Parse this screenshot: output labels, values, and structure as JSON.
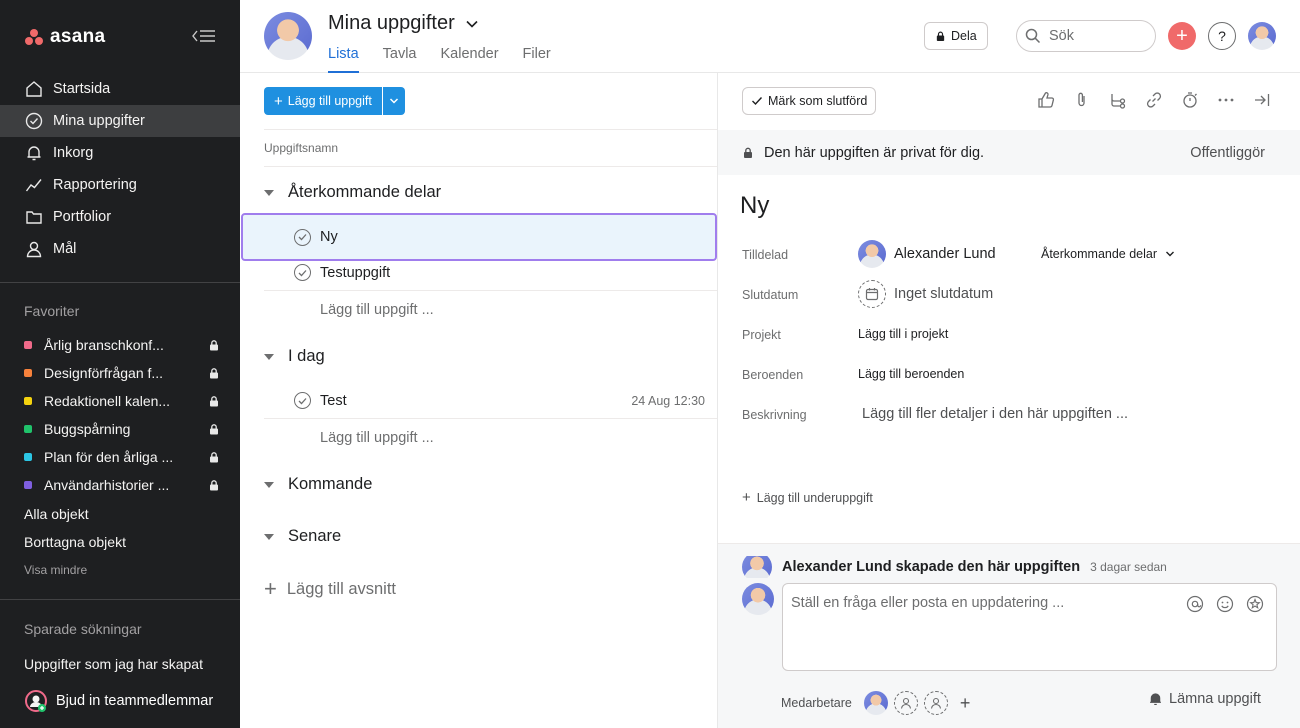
{
  "app": {
    "logo_text": "asana"
  },
  "sidebar": {
    "nav": [
      {
        "label": "Startsida",
        "icon": "home-icon"
      },
      {
        "label": "Mina uppgifter",
        "icon": "check-circle-icon"
      },
      {
        "label": "Inkorg",
        "icon": "bell-icon"
      },
      {
        "label": "Rapportering",
        "icon": "chart-line-icon"
      },
      {
        "label": "Portfolior",
        "icon": "folder-icon"
      },
      {
        "label": "Mål",
        "icon": "person-icon"
      }
    ],
    "favorites_title": "Favoriter",
    "favorites": [
      {
        "label": "Årlig branschkonf...",
        "color": "#f06a8a"
      },
      {
        "label": "Designförfrågan f...",
        "color": "#f8823c"
      },
      {
        "label": "Redaktionell kalen...",
        "color": "#f5d30f"
      },
      {
        "label": "Buggspårning",
        "color": "#20c26b"
      },
      {
        "label": "Plan för den årliga ...",
        "color": "#2cc6e5"
      },
      {
        "label": "Användarhistorier ...",
        "color": "#7f5fe0"
      }
    ],
    "all_objects": "Alla objekt",
    "deleted_objects": "Borttagna objekt",
    "show_less": "Visa mindre",
    "saved_searches_title": "Sparade sökningar",
    "saved_search_item": "Uppgifter som jag har skapat",
    "invite": "Bjud in teammedlemmar"
  },
  "header": {
    "title": "Mina uppgifter",
    "tabs": [
      "Lista",
      "Tavla",
      "Kalender",
      "Filer"
    ],
    "share": "Dela",
    "search_placeholder": "Sök",
    "help": "?"
  },
  "list": {
    "add_task": "Lägg till uppgift",
    "column_header": "Uppgiftsnamn",
    "sections": [
      {
        "title": "Återkommande delar",
        "tasks": [
          {
            "name": "Ny",
            "date": ""
          },
          {
            "name": "Testuppgift",
            "date": ""
          }
        ]
      },
      {
        "title": "I dag",
        "tasks": [
          {
            "name": "Test",
            "date": "24 Aug 12:30"
          }
        ]
      },
      {
        "title": "Kommande",
        "tasks": []
      },
      {
        "title": "Senare",
        "tasks": []
      }
    ],
    "add_task_inline": "Lägg till uppgift ...",
    "add_section": "Lägg till avsnitt"
  },
  "detail": {
    "mark_complete": "Märk som slutförd",
    "private_notice": "Den här uppgiften är privat för dig.",
    "publish": "Offentliggör",
    "title": "Ny",
    "fields": {
      "assignee_label": "Tilldelad",
      "assignee": "Alexander Lund",
      "section": "Återkommande delar",
      "due_label": "Slutdatum",
      "due": "Inget slutdatum",
      "projects_label": "Projekt",
      "projects": "Lägg till i projekt",
      "dependencies_label": "Beroenden",
      "dependencies": "Lägg till beroenden",
      "description_label": "Beskrivning",
      "description": "Lägg till fler detaljer i den här uppgiften ..."
    },
    "add_subtask": "Lägg till underuppgift",
    "activity": "Alexander Lund skapade den här uppgiften",
    "activity_when": "3 dagar sedan",
    "comment_placeholder": "Ställ en fråga eller posta en uppdatering ...",
    "collaborators_label": "Medarbetare",
    "leave_task": "Lämna uppgift"
  }
}
